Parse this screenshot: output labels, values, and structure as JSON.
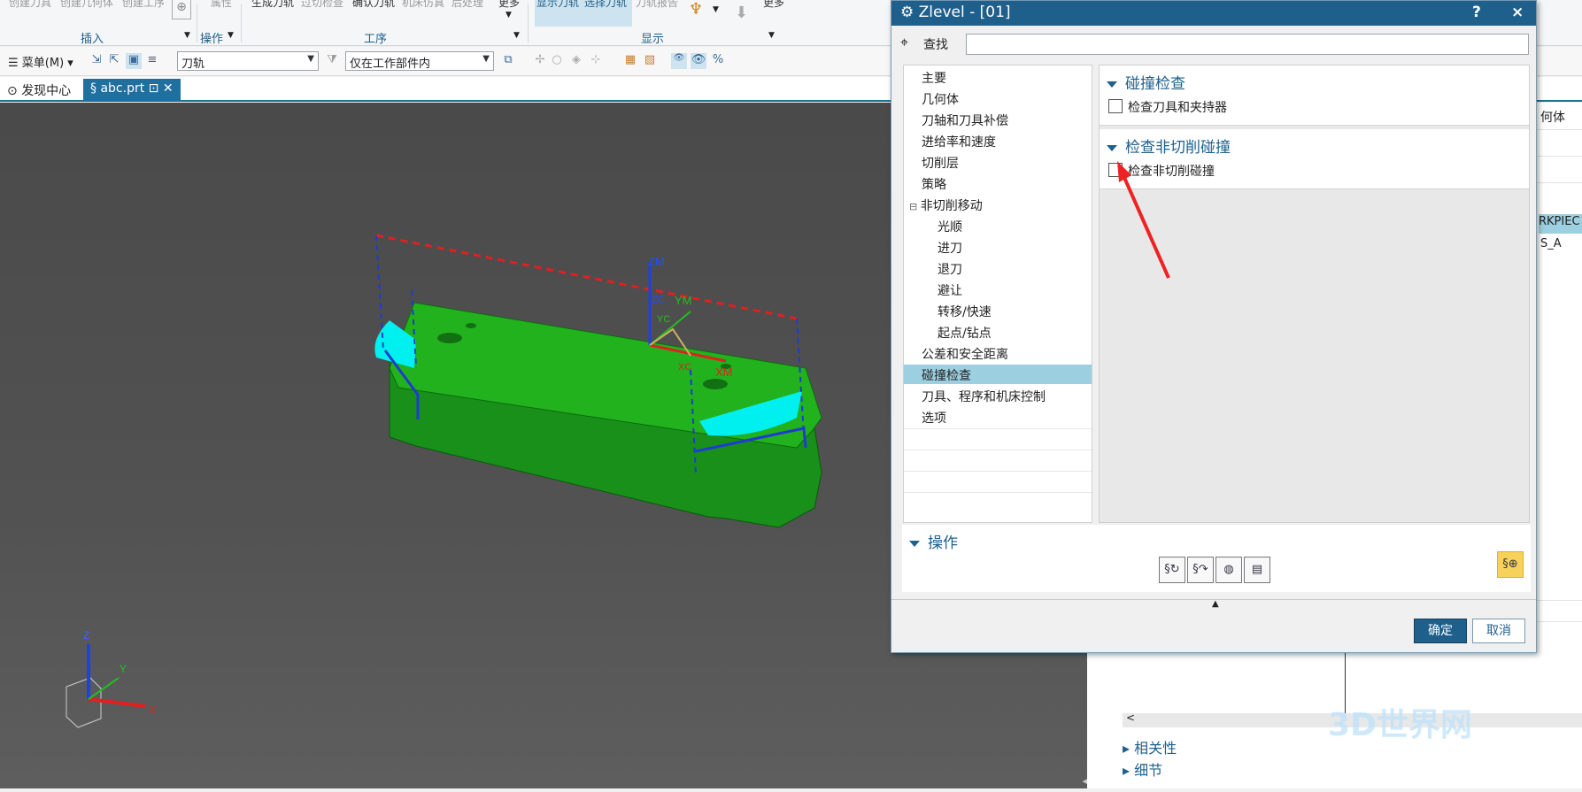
{
  "ribbon": {
    "top_items": [
      "创建刀具",
      "创建几何体",
      "创建工序",
      "属性",
      "生成刀轨",
      "过切检查",
      "确认刀轨",
      "机床仿真",
      "后处理",
      "更多",
      "显示刀轨",
      "选择刀轨",
      "刀轨报告",
      "更多"
    ],
    "groups": {
      "insert": "插入",
      "operation": "操作",
      "process": "工序",
      "display": "显示"
    }
  },
  "toolbar": {
    "menu_label": "菜单(M)",
    "filter_value": "刀轨",
    "scope_value": "仅在工作部件内"
  },
  "tabs": {
    "discover": "发现中心",
    "file": "abc.prt"
  },
  "viewport": {
    "csys_labels": {
      "zm": "ZM",
      "ym": "YM",
      "xm": "XM",
      "zc": "ZC",
      "yc": "YC",
      "xc": "XC"
    },
    "triad": {
      "z": "Z",
      "y": "Y",
      "x": "X"
    }
  },
  "right_panel": {
    "col_header": "何体",
    "cell1": "RKPIEC",
    "cell2": "S_A",
    "dependencies": "相关性",
    "details": "细节",
    "scroll_left": "<"
  },
  "dialog": {
    "title": "Zlevel  - [01]",
    "help": "?",
    "close": "×",
    "find_label": "查找",
    "find_value": "",
    "nav_items": [
      {
        "label": "主要",
        "sub": false
      },
      {
        "label": "几何体",
        "sub": false
      },
      {
        "label": "刀轴和刀具补偿",
        "sub": false
      },
      {
        "label": "进给率和速度",
        "sub": false
      },
      {
        "label": "切削层",
        "sub": false
      },
      {
        "label": "策略",
        "sub": false
      },
      {
        "label": "非切削移动",
        "sub": false
      },
      {
        "label": "光顺",
        "sub": true
      },
      {
        "label": "进刀",
        "sub": true
      },
      {
        "label": "退刀",
        "sub": true
      },
      {
        "label": "避让",
        "sub": true
      },
      {
        "label": "转移/快速",
        "sub": true
      },
      {
        "label": "起点/钻点",
        "sub": true
      },
      {
        "label": "公差和安全距离",
        "sub": false
      },
      {
        "label": "碰撞检查",
        "sub": false
      },
      {
        "label": "刀具、程序和机床控制",
        "sub": false
      },
      {
        "label": "选项",
        "sub": false
      }
    ],
    "active_nav": "碰撞检查",
    "section1": {
      "title": "碰撞检查",
      "check_label": "检查刀具和夹持器",
      "checked": false
    },
    "section2": {
      "title": "检查非切削碰撞",
      "check_label": "检查非切削碰撞",
      "checked": false
    },
    "ops_title": "操作",
    "ok": "确定",
    "cancel": "取消"
  },
  "watermark": "3D世界网",
  "colors": {
    "accent": "#1f5f8b",
    "part": "#1ea31a",
    "highlight": "#9ccfe0",
    "path_blue": "#1e3ccf",
    "path_red": "#e02020"
  }
}
